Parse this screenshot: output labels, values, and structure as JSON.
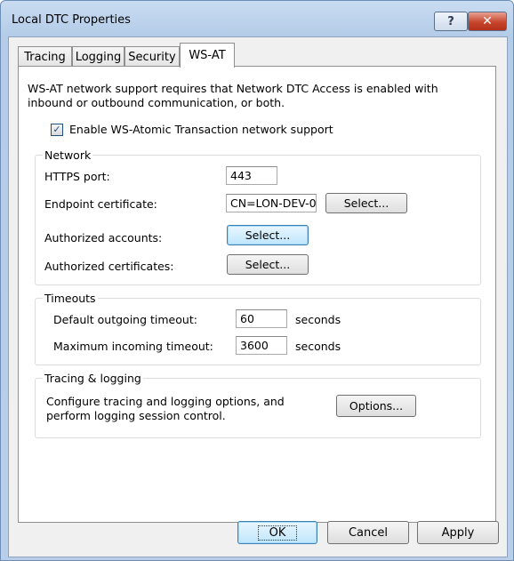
{
  "window": {
    "title": "Local DTC Properties",
    "help_glyph": "?",
    "close_glyph": "✕"
  },
  "tabs": [
    {
      "label": "Tracing"
    },
    {
      "label": "Logging"
    },
    {
      "label": "Security"
    },
    {
      "label": "WS-AT",
      "active": true
    }
  ],
  "description": "WS-AT network support requires that Network DTC Access is enabled with inbound or outbound communication, or both.",
  "enable": {
    "label": "Enable WS-Atomic Transaction network support",
    "checked": true,
    "check_glyph": "✓"
  },
  "network": {
    "group_label": "Network",
    "https_port_label": "HTTPS port:",
    "https_port_value": "443",
    "endpoint_cert_label": "Endpoint certificate:",
    "endpoint_cert_value": "CN=LON-DEV-0",
    "endpoint_select_label": "Select...",
    "authorized_accounts_label": "Authorized accounts:",
    "authorized_accounts_select_label": "Select...",
    "authorized_certs_label": "Authorized certificates:",
    "authorized_certs_select_label": "Select..."
  },
  "timeouts": {
    "group_label": "Timeouts",
    "outgoing_label": "Default outgoing timeout:",
    "outgoing_value": "60",
    "outgoing_unit": "seconds",
    "incoming_label": "Maximum incoming timeout:",
    "incoming_value": "3600",
    "incoming_unit": "seconds"
  },
  "tracing": {
    "group_label": "Tracing & logging",
    "description": "Configure tracing and logging options, and perform logging session control.",
    "options_label": "Options..."
  },
  "footer": {
    "ok_label": "OK",
    "cancel_label": "Cancel",
    "apply_label": "Apply"
  }
}
